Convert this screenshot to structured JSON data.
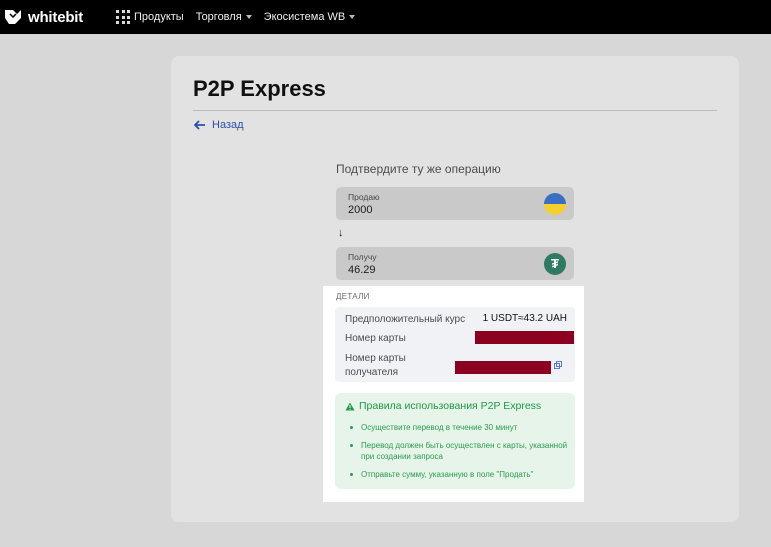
{
  "header": {
    "logo_text": "whitebit",
    "nav": [
      {
        "label": "Продукты",
        "icon": "grid-icon"
      },
      {
        "label": "Торговля",
        "icon": "chevron-down-icon"
      },
      {
        "label": "Экосистема WB",
        "icon": "chevron-down-icon"
      }
    ]
  },
  "page": {
    "title": "P2P Express",
    "back_label": "Назад"
  },
  "exchange": {
    "subtitle": "Подтвердите ту же операцию",
    "sell": {
      "label": "Продаю",
      "value": "2000",
      "currency_icon": "uah-flag-icon"
    },
    "arrow": "↓",
    "get": {
      "label": "Получу",
      "value": "46.29",
      "currency_icon": "tether-icon"
    }
  },
  "details": {
    "heading": "ДЕТАЛИ",
    "rate_label": "Предположительный курс",
    "rate_value": "1 USDT≈43.2 UAH",
    "card_label": "Номер карты",
    "recipient_label_1": "Номер карты",
    "recipient_label_2": "получателя"
  },
  "rules": {
    "title": "Правила использования P2P Express",
    "items": [
      "Осуществите перевод в течение 30 минут",
      "Перевод должен быть осуществлен с карты, указанной при создании запроса",
      "Отправьте сумму, указанную в поле \"Продать\""
    ]
  },
  "colors": {
    "accent_link": "#2a4fa8",
    "rules_green": "#1e9a45",
    "redaction": "#8c0020"
  }
}
